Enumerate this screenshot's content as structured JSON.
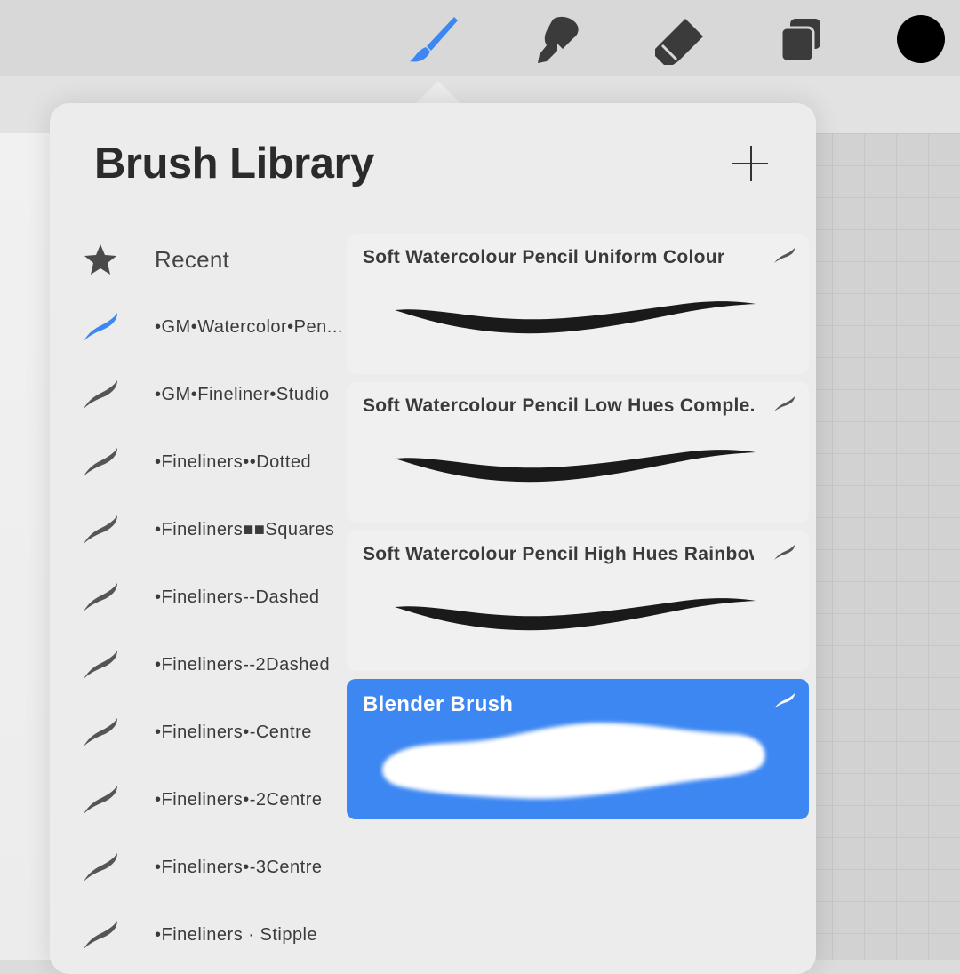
{
  "toolbar": {
    "tools": [
      {
        "name": "brush-tool",
        "active": true
      },
      {
        "name": "smudge-tool",
        "active": false
      },
      {
        "name": "eraser-tool",
        "active": false
      },
      {
        "name": "layers-tool",
        "active": false
      }
    ],
    "current_color": "#000000",
    "active_color": "#3d87f2"
  },
  "brush_library": {
    "title": "Brush Library",
    "add_icon": "plus-icon",
    "sets": [
      {
        "label": "Recent",
        "icon": "star-icon",
        "selected": false
      },
      {
        "label": "•GM•Watercolor•Pen...",
        "icon": "brush-stroke-icon",
        "selected": true
      },
      {
        "label": "•GM•Fineliner•Studio",
        "icon": "brush-stroke-icon",
        "selected": false
      },
      {
        "label": "•Fineliners••Dotted",
        "icon": "brush-stroke-icon",
        "selected": false
      },
      {
        "label": "•Fineliners■■Squares",
        "icon": "brush-stroke-icon",
        "selected": false
      },
      {
        "label": "•Fineliners--Dashed",
        "icon": "brush-stroke-icon",
        "selected": false
      },
      {
        "label": "•Fineliners--2Dashed",
        "icon": "brush-stroke-icon",
        "selected": false
      },
      {
        "label": "•Fineliners•-Centre",
        "icon": "brush-stroke-icon",
        "selected": false
      },
      {
        "label": "•Fineliners•-2Centre",
        "icon": "brush-stroke-icon",
        "selected": false
      },
      {
        "label": "•Fineliners•-3Centre",
        "icon": "brush-stroke-icon",
        "selected": false
      },
      {
        "label": "•Fineliners · Stipple",
        "icon": "brush-stroke-icon",
        "selected": false
      }
    ],
    "brushes": [
      {
        "name": "Soft Watercolour Pencil Uniform Colour",
        "selected": false
      },
      {
        "name": "Soft Watercolour Pencil Low Hues Comple...",
        "selected": false
      },
      {
        "name": "Soft Watercolour Pencil High Hues Rainbow",
        "selected": false
      },
      {
        "name": "Blender Brush",
        "selected": true
      }
    ]
  }
}
